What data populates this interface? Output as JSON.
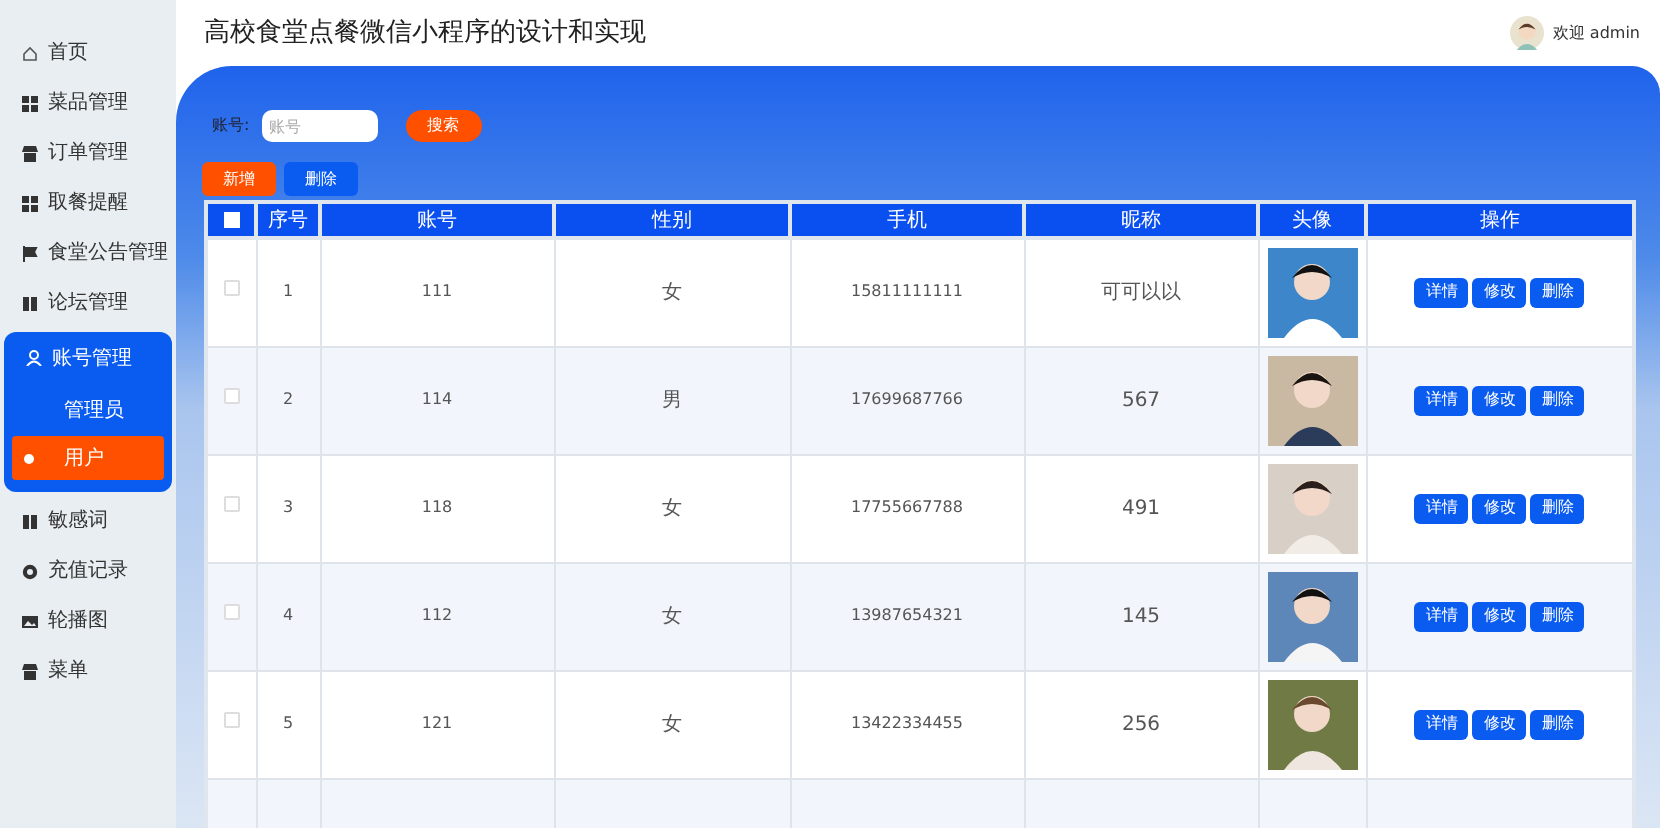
{
  "sidebar": {
    "items": [
      {
        "label": "首页",
        "selected": false
      },
      {
        "label": "菜品管理",
        "selected": false
      },
      {
        "label": "订单管理",
        "selected": false
      },
      {
        "label": "取餐提醒",
        "selected": false
      },
      {
        "label": "食堂公告管理",
        "selected": false
      },
      {
        "label": "论坛管理",
        "selected": false
      },
      {
        "label": "账号管理",
        "selected": false,
        "expanded": true,
        "children": [
          {
            "label": "管理员",
            "selected": false
          },
          {
            "label": "用户",
            "selected": true
          }
        ]
      },
      {
        "label": "敏感词",
        "selected": false
      },
      {
        "label": "充值记录",
        "selected": false
      },
      {
        "label": "轮播图",
        "selected": false
      },
      {
        "label": "菜单",
        "selected": false
      }
    ]
  },
  "header": {
    "title": "高校食堂点餐微信小程序的设计和实现",
    "welcome": "欢迎 admin"
  },
  "search": {
    "label": "账号:",
    "placeholder": "账号",
    "button": "搜索"
  },
  "toolbar": [
    {
      "label": "新增",
      "kind": "add"
    },
    {
      "label": "删除",
      "kind": "delete"
    }
  ],
  "table": {
    "select_all_checked": false,
    "columns": [
      "序号",
      "账号",
      "性别",
      "手机",
      "昵称",
      "头像",
      "操作"
    ],
    "rows": [
      {
        "checked": false,
        "index": "1",
        "account": "111",
        "gender": "女",
        "phone": "15811111111",
        "nickname": "可可以以",
        "actions": [
          "详情",
          "修改",
          "删除"
        ]
      },
      {
        "checked": false,
        "index": "2",
        "account": "114",
        "gender": "男",
        "phone": "17699687766",
        "nickname": "567",
        "actions": [
          "详情",
          "修改",
          "删除"
        ]
      },
      {
        "checked": false,
        "index": "3",
        "account": "118",
        "gender": "女",
        "phone": "17755667788",
        "nickname": "491",
        "actions": [
          "详情",
          "修改",
          "删除"
        ]
      },
      {
        "checked": false,
        "index": "4",
        "account": "112",
        "gender": "女",
        "phone": "13987654321",
        "nickname": "145",
        "actions": [
          "详情",
          "修改",
          "删除"
        ]
      },
      {
        "checked": false,
        "index": "5",
        "account": "121",
        "gender": "女",
        "phone": "13422334455",
        "nickname": "256",
        "actions": [
          "详情",
          "修改",
          "删除"
        ]
      }
    ]
  }
}
